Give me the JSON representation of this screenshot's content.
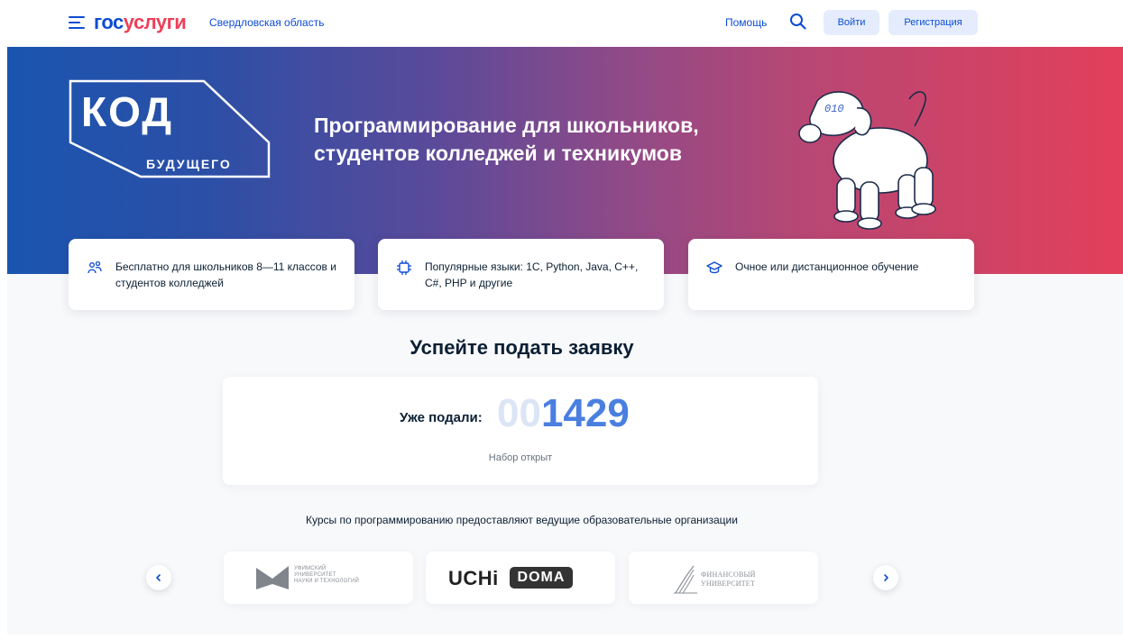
{
  "header": {
    "logo_part1": "гос",
    "logo_part2": "услуги",
    "region": "Свердловская область",
    "help": "Помощь",
    "login": "Войти",
    "register": "Регистрация"
  },
  "banner": {
    "logo_main": "КОД",
    "logo_sub": "БУДУЩЕГО",
    "title": "Программирование для школьников, студентов колледжей и техникумов",
    "dog_label": "010"
  },
  "features": [
    {
      "icon": "people-icon",
      "text": "Бесплатно для школьников 8—11 классов и студентов колледжей"
    },
    {
      "icon": "chip-icon",
      "text": "Популярные языки: 1С, Python, Java, C++, C#, PHP и другие"
    },
    {
      "icon": "graduation-cap-icon",
      "text": "Очное или дистанционное обучение"
    }
  ],
  "apply": {
    "title": "Успейте подать заявку",
    "counter_label": "Уже подали:",
    "counter_zeros": "00",
    "counter_value": "1429",
    "status": "Набор открыт"
  },
  "courses_text": "Курсы по программированию предоставляют ведущие образовательные организации",
  "partners": [
    {
      "line1": "УФИМСКИЙ",
      "line2": "УНИВЕРСИТЕТ",
      "line3": "НАУКИ И ТЕХНОЛОГИЙ"
    },
    {
      "brand": "UCHi",
      "badge": "DOMA"
    },
    {
      "line1": "ФИНАНСОВЫЙ",
      "line2": "УНИВЕРСИТЕТ"
    }
  ],
  "colors": {
    "brand_blue": "#0d4cd3",
    "brand_red": "#ee3f58",
    "counter_blue": "#4a7fe0"
  }
}
